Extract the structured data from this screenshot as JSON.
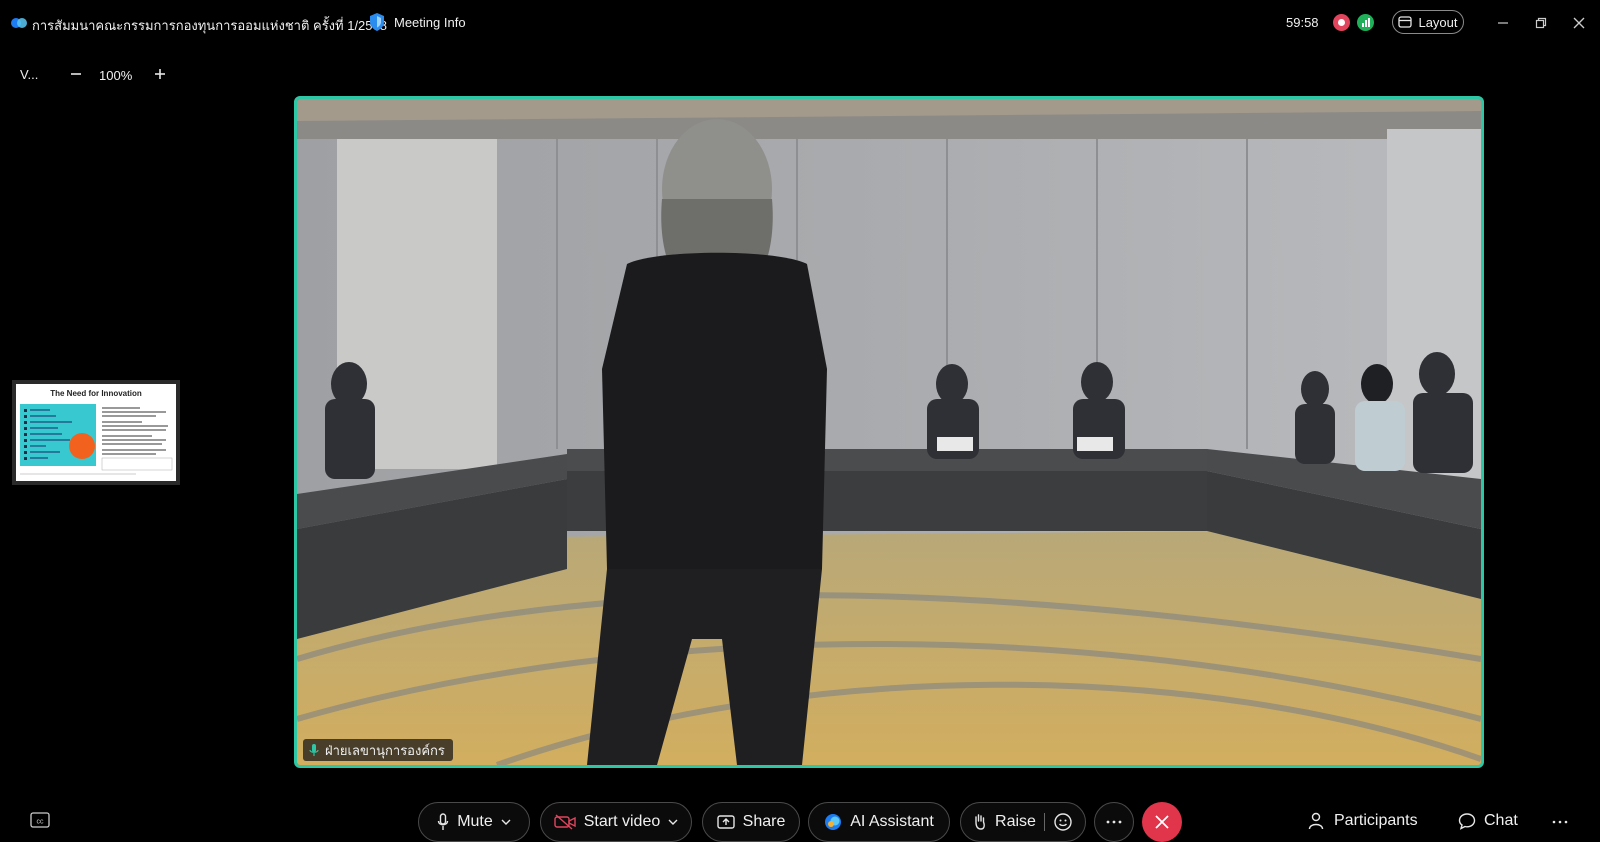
{
  "window": {
    "meeting_title": "การสัมมนาคณะกรรมการกองทุนการออมแห่งชาติ ครั้งที่ 1/2568",
    "meeting_info_label": "Meeting Info",
    "timer": "59:58",
    "layout_label": "Layout"
  },
  "view_controls": {
    "view_label": "V...",
    "zoom_level": "100%"
  },
  "thumbnail": {
    "slide_title": "The Need for Innovation"
  },
  "video": {
    "participant_name": "ฝ่ายเลขานุการองค์กร"
  },
  "toolbar": {
    "mute_label": "Mute",
    "start_video_label": "Start video",
    "share_label": "Share",
    "ai_assistant_label": "AI Assistant",
    "raise_label": "Raise",
    "participants_label": "Participants",
    "chat_label": "Chat"
  },
  "colors": {
    "active_speaker_border": "#2ec7a5",
    "end_call": "#e0354b",
    "video_off": "#e0455d",
    "recording": "#e0455d",
    "signal": "#21b05a"
  },
  "icons": [
    "app-logo-icon",
    "shield-icon",
    "recording-icon",
    "signal-icon",
    "layout-icon",
    "minimize-icon",
    "restore-icon",
    "close-icon",
    "zoom-out-icon",
    "zoom-in-icon",
    "mic-icon",
    "chevron-down-icon",
    "video-off-icon",
    "share-screen-icon",
    "ai-assistant-icon",
    "raise-hand-icon",
    "reaction-icon",
    "more-icon",
    "end-call-icon",
    "participants-icon",
    "chat-icon",
    "captions-icon"
  ]
}
